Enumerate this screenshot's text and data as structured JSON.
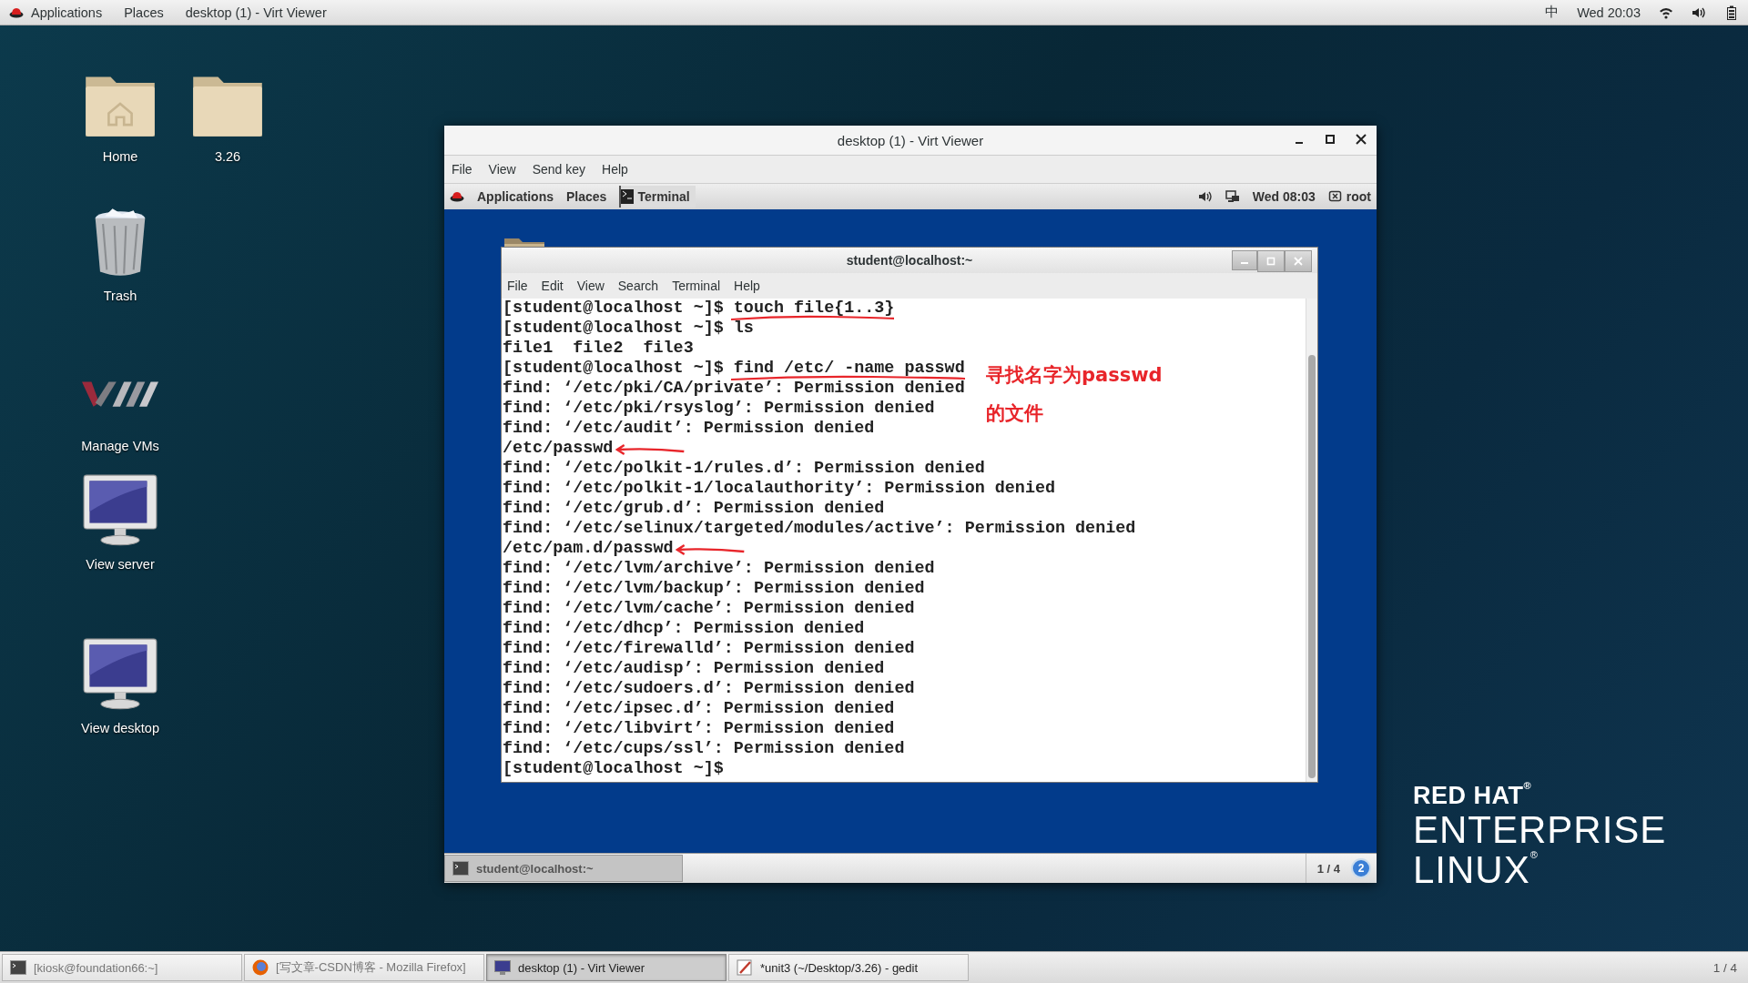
{
  "top_bar": {
    "menus": [
      "Applications",
      "Places"
    ],
    "window_title": "desktop (1) - Virt Viewer",
    "input_method": "中",
    "clock": "Wed 20:03"
  },
  "desktop_icons": [
    {
      "kind": "home",
      "label": "Home"
    },
    {
      "kind": "folder",
      "label": "3.26"
    },
    {
      "kind": "trash",
      "label": "Trash"
    },
    {
      "kind": "vm",
      "label": "Manage VMs"
    },
    {
      "kind": "monitor",
      "label": "View server"
    },
    {
      "kind": "monitor",
      "label": "View desktop"
    }
  ],
  "viewer": {
    "title": "desktop (1) - Virt Viewer",
    "menu": [
      "File",
      "View",
      "Send key",
      "Help"
    ],
    "guest_bar": {
      "menus": [
        "Applications",
        "Places"
      ],
      "active_app": "Terminal",
      "clock": "Wed 08:03",
      "user": "root"
    },
    "terminal": {
      "title": "student@localhost:~",
      "menu": [
        "File",
        "Edit",
        "View",
        "Search",
        "Terminal",
        "Help"
      ],
      "lines": [
        {
          "kind": "prompt",
          "prompt": "[student@localhost ~]$",
          "command": "touch file{1..3}",
          "underlined": true
        },
        {
          "kind": "prompt",
          "prompt": "[student@localhost ~]$",
          "command": "ls"
        },
        {
          "kind": "output",
          "text": "file1  file2  file3"
        },
        {
          "kind": "prompt",
          "prompt": "[student@localhost ~]$",
          "command": "find /etc/ -name passwd",
          "underlined": true
        },
        {
          "kind": "output",
          "text": "find: ‘/etc/pki/CA/private’: Permission denied"
        },
        {
          "kind": "output",
          "text": "find: ‘/etc/pki/rsyslog’: Permission denied"
        },
        {
          "kind": "output",
          "text": "find: ‘/etc/audit’: Permission denied"
        },
        {
          "kind": "output",
          "text": "/etc/passwd",
          "arrowed": true
        },
        {
          "kind": "output",
          "text": "find: ‘/etc/polkit-1/rules.d’: Permission denied"
        },
        {
          "kind": "output",
          "text": "find: ‘/etc/polkit-1/localauthority’: Permission denied"
        },
        {
          "kind": "output",
          "text": "find: ‘/etc/grub.d’: Permission denied"
        },
        {
          "kind": "output",
          "text": "find: ‘/etc/selinux/targeted/modules/active’: Permission denied"
        },
        {
          "kind": "output",
          "text": "/etc/pam.d/passwd",
          "arrowed": true
        },
        {
          "kind": "output",
          "text": "find: ‘/etc/lvm/archive’: Permission denied"
        },
        {
          "kind": "output",
          "text": "find: ‘/etc/lvm/backup’: Permission denied"
        },
        {
          "kind": "output",
          "text": "find: ‘/etc/lvm/cache’: Permission denied"
        },
        {
          "kind": "output",
          "text": "find: ‘/etc/dhcp’: Permission denied"
        },
        {
          "kind": "output",
          "text": "find: ‘/etc/firewalld’: Permission denied"
        },
        {
          "kind": "output",
          "text": "find: ‘/etc/audisp’: Permission denied"
        },
        {
          "kind": "output",
          "text": "find: ‘/etc/sudoers.d’: Permission denied"
        },
        {
          "kind": "output",
          "text": "find: ‘/etc/ipsec.d’: Permission denied"
        },
        {
          "kind": "output",
          "text": "find: ‘/etc/libvirt’: Permission denied"
        },
        {
          "kind": "output",
          "text": "find: ‘/etc/cups/ssl’: Permission denied"
        },
        {
          "kind": "prompt",
          "prompt": "[student@localhost ~]$"
        }
      ],
      "note": [
        "寻找名字为passwd",
        "的文件"
      ]
    },
    "guest_taskbar": {
      "window": "student@localhost:~",
      "workspace": "1 / 4",
      "notifications": "2"
    }
  },
  "branding": [
    "RED HAT$^{®}$",
    "ENTERPRISE",
    "LINUX$^{®}$"
  ],
  "taskbar": {
    "items": [
      {
        "kind": "terminal",
        "label": "[kiosk@foundation66:~]",
        "minimized": true,
        "selected": false
      },
      {
        "kind": "browser",
        "label": "[写文章-CSDN博客 - Mozilla Firefox]",
        "minimized": true,
        "selected": false
      },
      {
        "kind": "viewer",
        "label": "desktop (1) - Virt Viewer",
        "minimized": false,
        "selected": true
      },
      {
        "kind": "editor",
        "label": "*unit3 (~/Desktop/3.26) - gedit",
        "minimized": false,
        "selected": false
      }
    ],
    "workspace": "1 / 4"
  }
}
